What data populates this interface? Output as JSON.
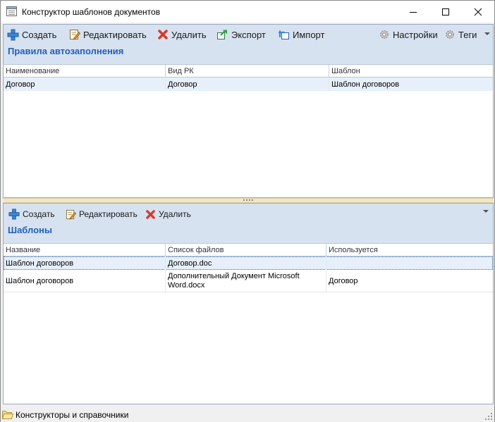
{
  "window": {
    "title": "Конструктор шаблонов документов",
    "icons": {
      "app": "form-icon",
      "minimize": "minimize-icon",
      "maximize": "maximize-icon",
      "close": "close-icon"
    }
  },
  "rules": {
    "toolbar": {
      "create": "Создать",
      "edit": "Редактировать",
      "delete": "Удалить",
      "export": "Экспорт",
      "import": "Импорт",
      "settings": "Настройки",
      "tags": "Теги"
    },
    "title": "Правила автозаполнения",
    "columns": [
      "Наименование",
      "Вид РК",
      "Шаблон"
    ],
    "rows": [
      [
        "Договор",
        "Договор",
        "Шаблон договоров"
      ]
    ]
  },
  "templates": {
    "toolbar": {
      "create": "Создать",
      "edit": "Редактировать",
      "delete": "Удалить"
    },
    "title": "Шаблоны",
    "columns": [
      "Название",
      "Список файлов",
      "Используется"
    ],
    "rows": [
      [
        "Шаблон договоров",
        "Договор.doc",
        ""
      ],
      [
        "Шаблон договоров",
        "Дополнительный Документ Microsoft Word.docx",
        "Договор"
      ]
    ]
  },
  "statusbar": {
    "text": "Конструкторы и справочники"
  },
  "colors": {
    "accent": "#1f5fbf",
    "panel_header": "#d7e2f0",
    "splitter": "#f2e6c9"
  }
}
